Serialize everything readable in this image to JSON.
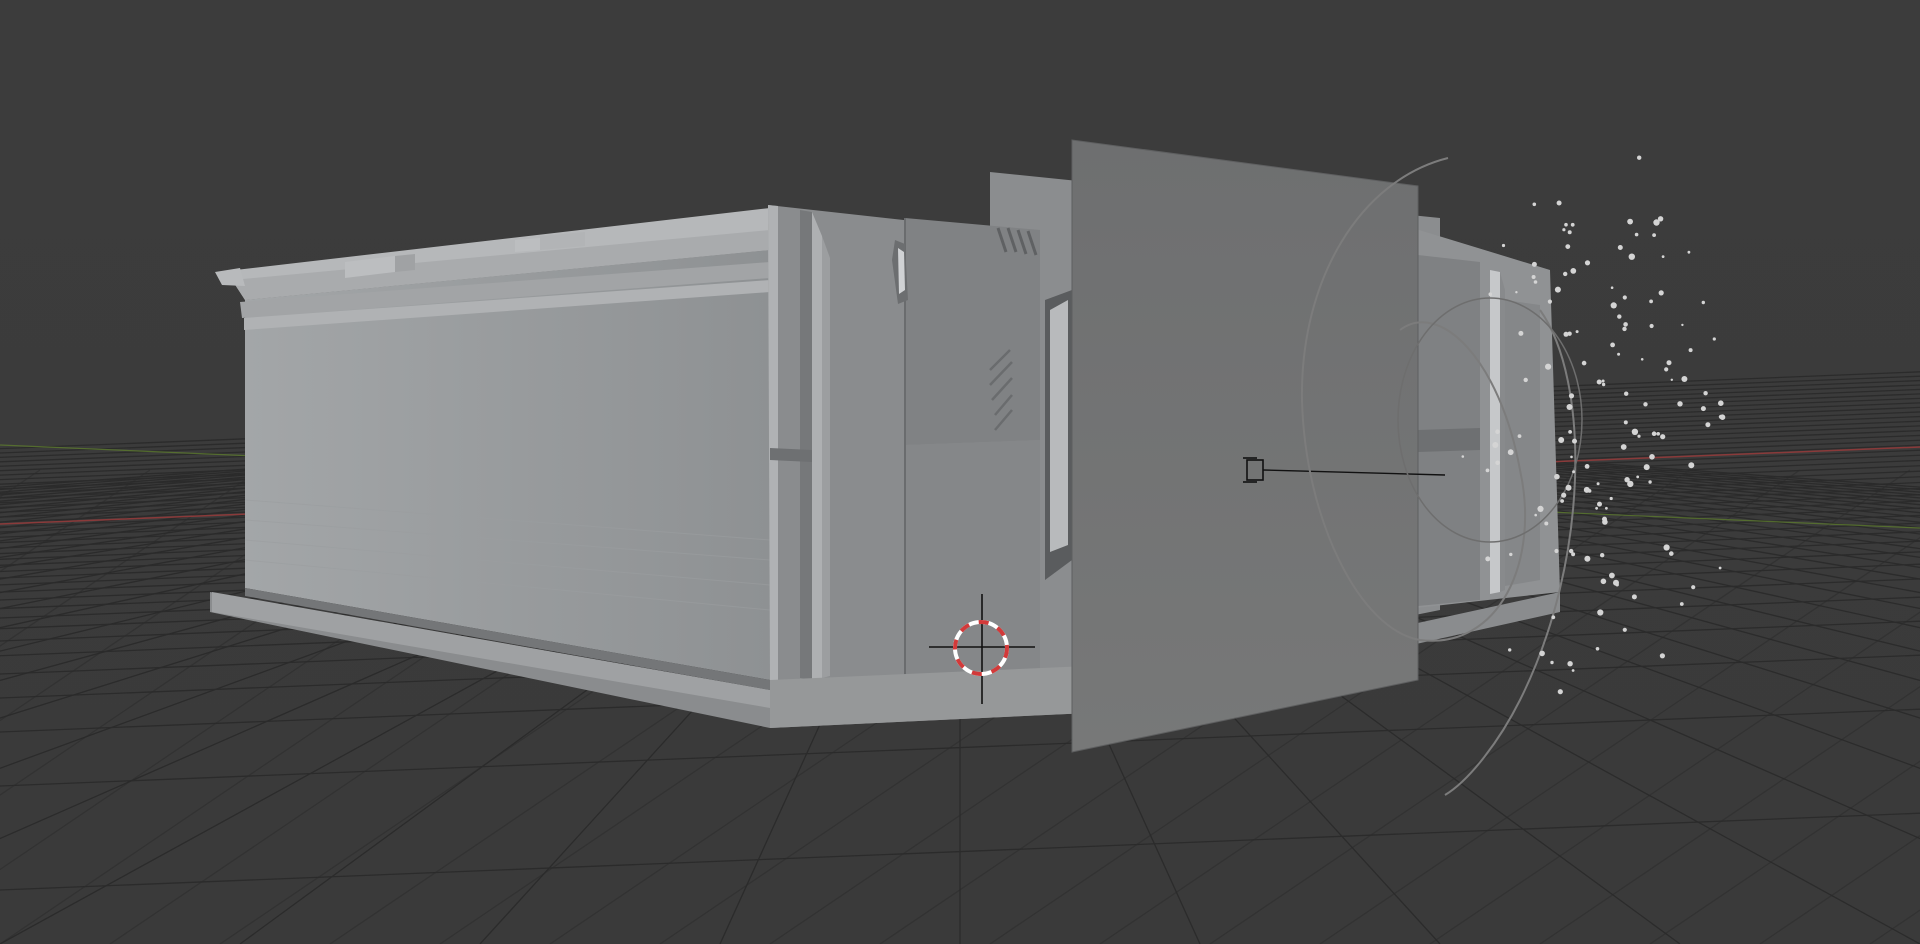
{
  "viewport": {
    "name": "3D Viewport",
    "shading": "solid",
    "background_color": "#3d3d3d",
    "grid_color": "#2b2b2b",
    "axis_x_color": "#8a3a3a",
    "axis_y_color": "#5c7a2e",
    "mesh_color": "#9a9c9e",
    "mesh_shadow_color": "#6f7173",
    "plane_color": "#787878",
    "cursor_ring_colors": [
      "#d23a3a",
      "#ffffff"
    ]
  },
  "scene_objects": [
    {
      "name": "building-wall-mesh",
      "type": "mesh"
    },
    {
      "name": "image-plane",
      "type": "mesh"
    },
    {
      "name": "camera",
      "type": "camera"
    },
    {
      "name": "particle-emitter",
      "type": "particles"
    },
    {
      "name": "curve-path",
      "type": "curve"
    },
    {
      "name": "3d-cursor",
      "type": "cursor"
    }
  ]
}
